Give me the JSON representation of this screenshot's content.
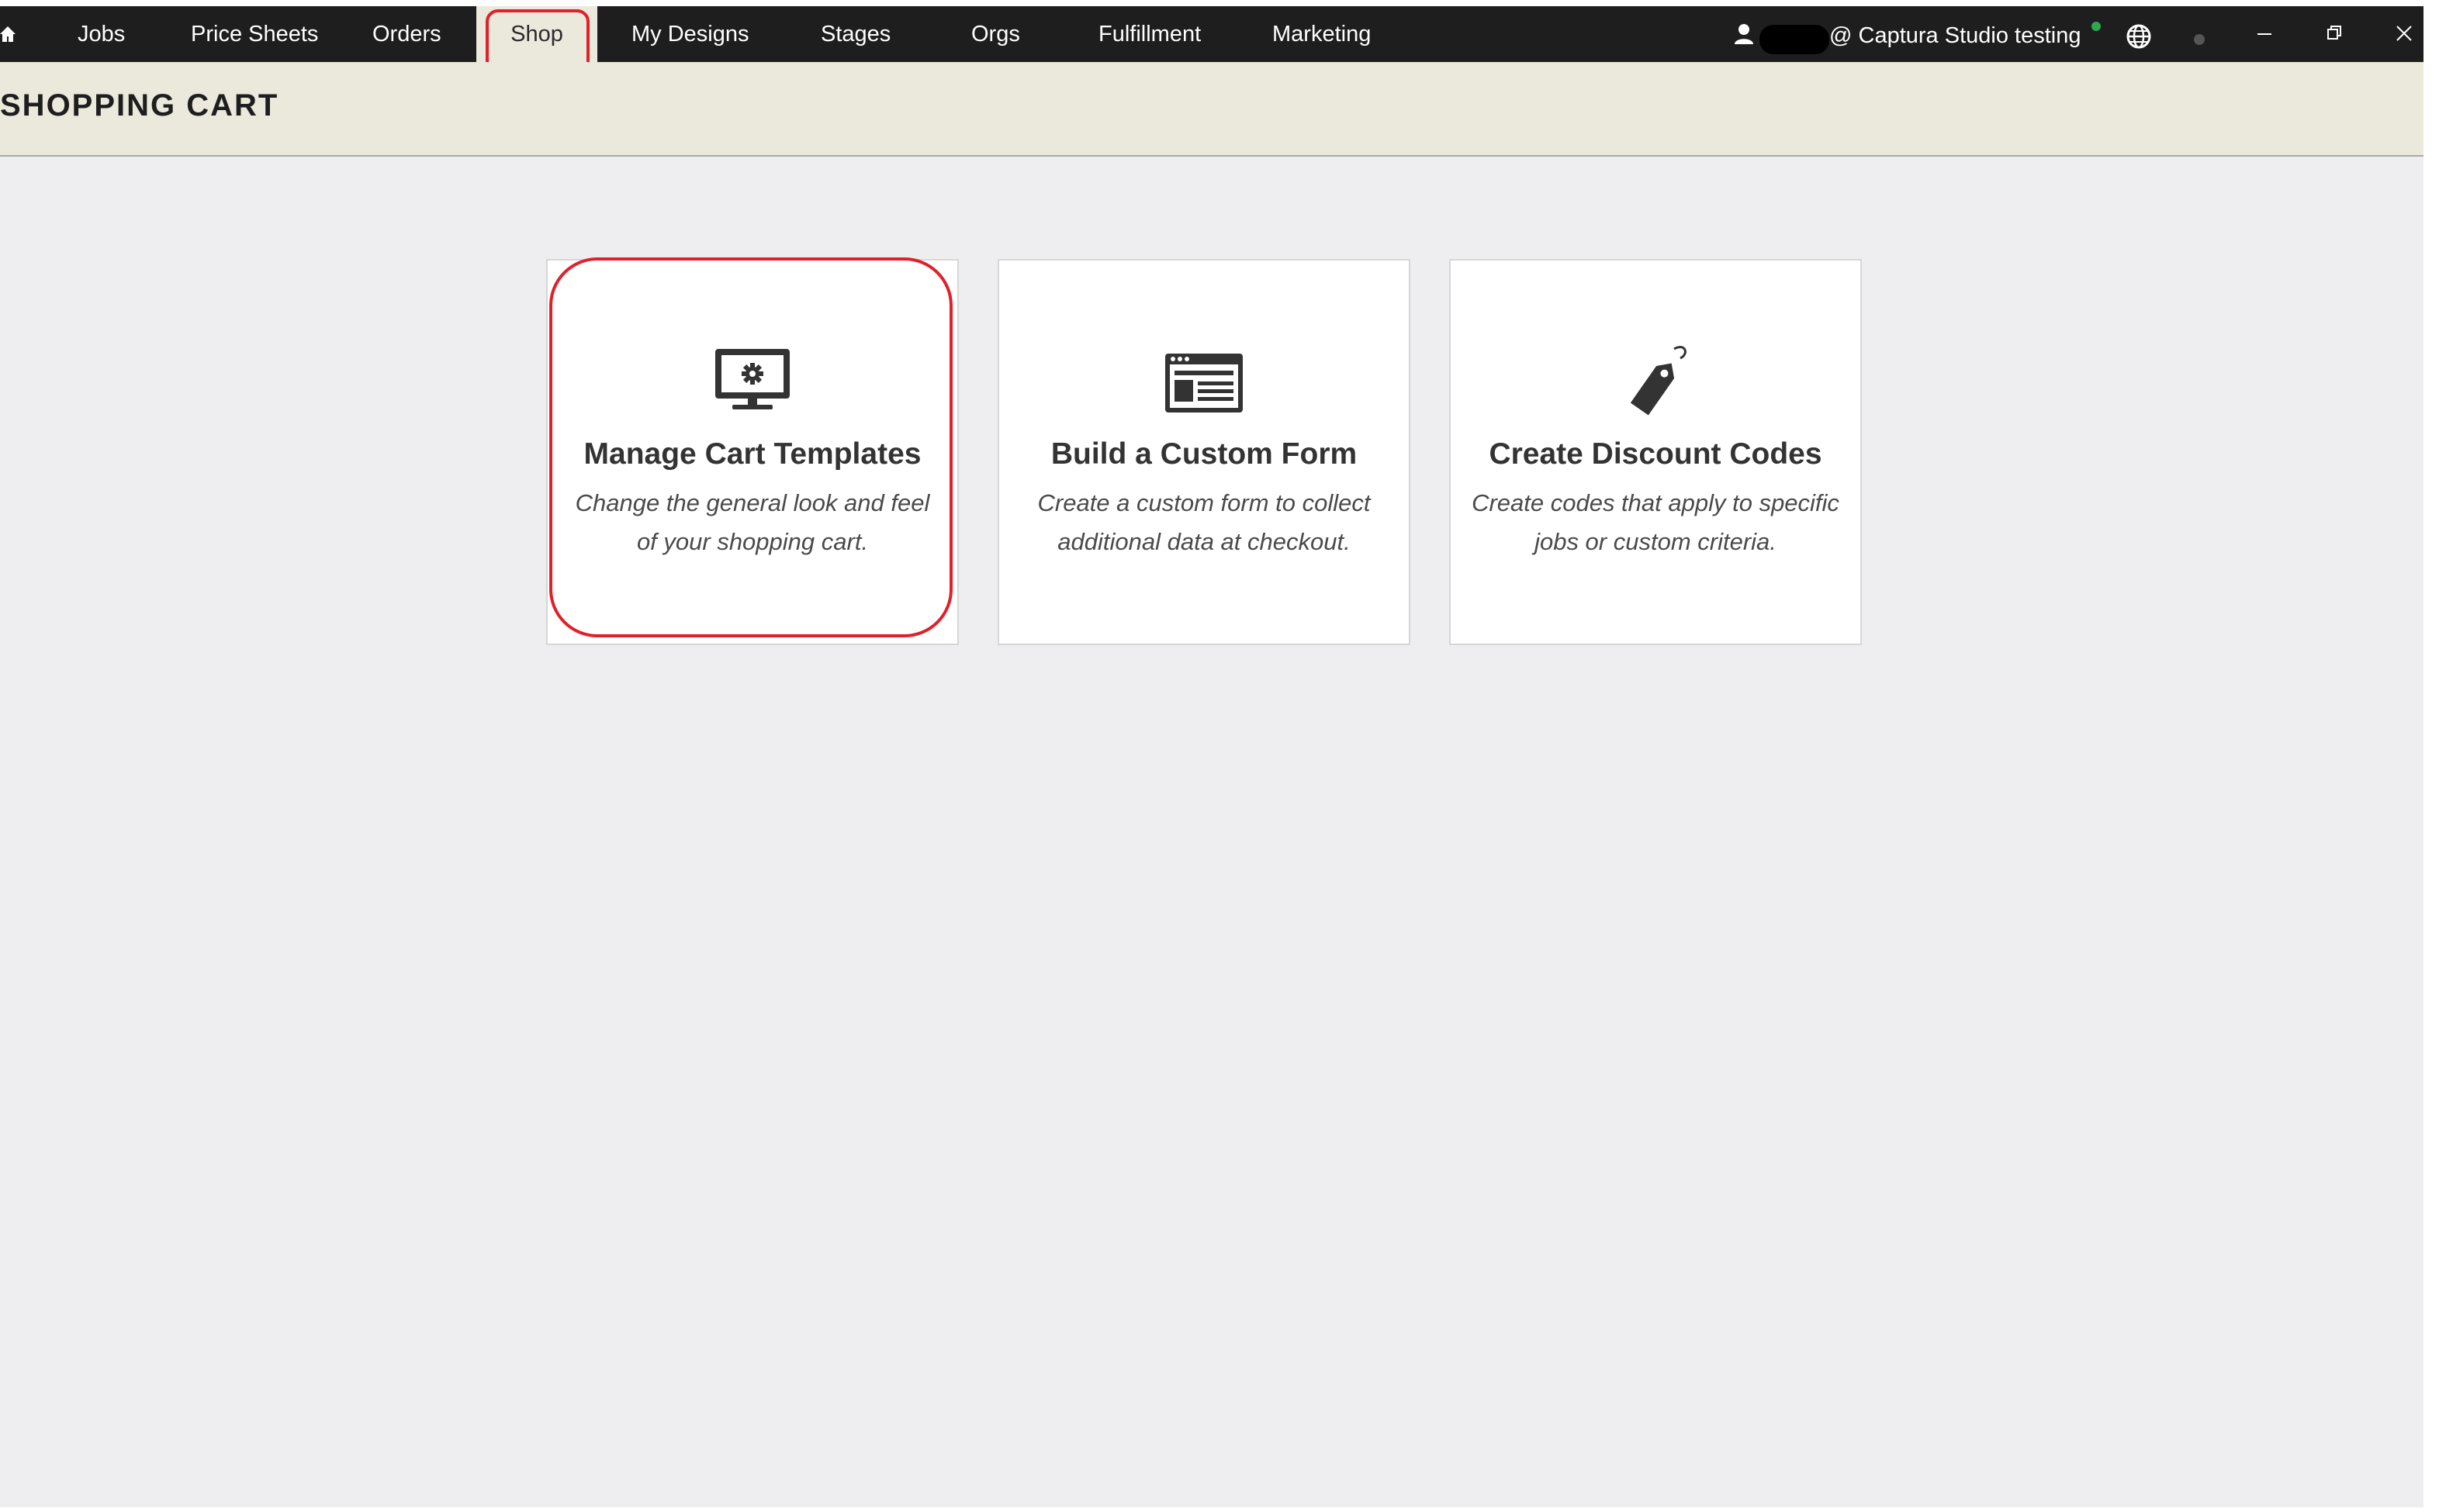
{
  "nav": {
    "items": [
      {
        "label": "Jobs"
      },
      {
        "label": "Price Sheets"
      },
      {
        "label": "Orders"
      },
      {
        "label": "Shop"
      },
      {
        "label": "My Designs"
      },
      {
        "label": "Stages"
      },
      {
        "label": "Orgs"
      },
      {
        "label": "Fulfillment"
      },
      {
        "label": "Marketing"
      }
    ],
    "active": "Shop",
    "account": "@ Captura Studio testing"
  },
  "page": {
    "title": "SHOPPING CART"
  },
  "cards": [
    {
      "title": "Manage Cart Templates",
      "description": "Change the general look and feel of your shopping cart.",
      "icon": "monitor-gear-icon",
      "highlighted": true
    },
    {
      "title": "Build a Custom Form",
      "description": "Create a custom form to collect additional data at checkout.",
      "icon": "form-window-icon",
      "highlighted": false
    },
    {
      "title": "Create Discount Codes",
      "description": "Create codes that apply to specific jobs or custom criteria.",
      "icon": "price-tag-icon",
      "highlighted": false
    }
  ],
  "colors": {
    "topbar": "#1e1e1e",
    "header": "#ebe8dc",
    "content": "#eeeef0",
    "highlight": "#e0202a",
    "online": "#2ea84f"
  }
}
